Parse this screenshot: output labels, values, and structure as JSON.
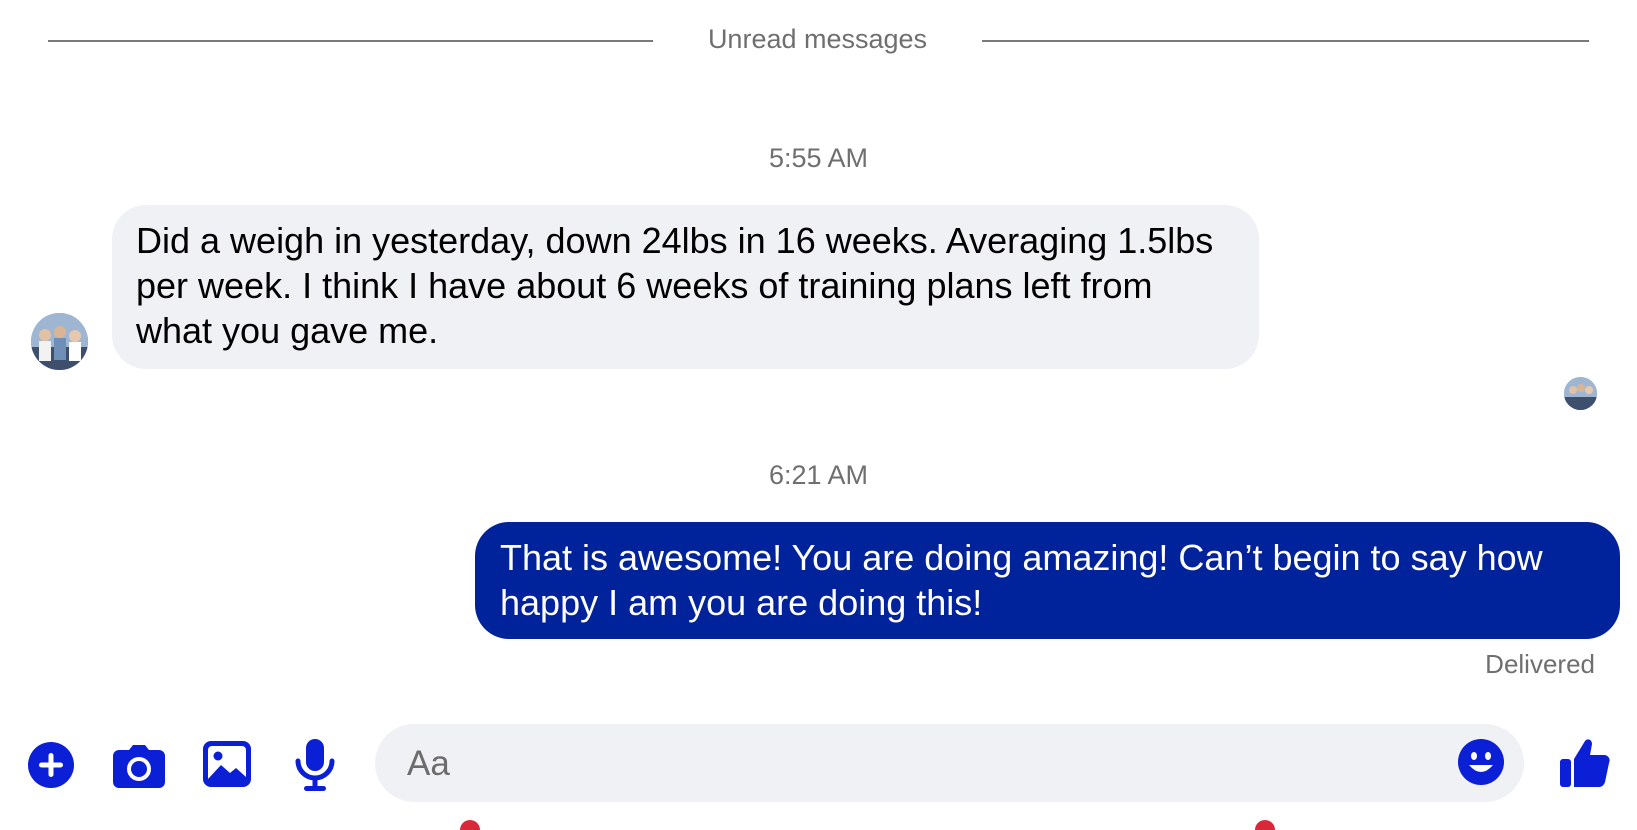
{
  "divider": {
    "label": "Unread messages"
  },
  "messages": [
    {
      "timestamp": "5:55 AM",
      "direction": "incoming",
      "text": "Did a weigh in yesterday, down 24lbs in 16 weeks. Averaging 1.5lbs per week. I think I have about 6 weeks of training plans left from what you gave me."
    },
    {
      "timestamp": "6:21 AM",
      "direction": "outgoing",
      "text": "That is awesome! You are doing amazing! Can’t begin to say how happy I am you are doing this!",
      "status": "Delivered"
    }
  ],
  "composer": {
    "placeholder": "Aa",
    "icons": [
      "plus-icon",
      "camera-icon",
      "gallery-icon",
      "microphone-icon",
      "emoji-icon",
      "thumbs-up-icon"
    ]
  },
  "colors": {
    "accent": "#0a1fd6",
    "outgoing_bubble": "#00229a",
    "incoming_bubble": "#f0f1f5",
    "muted_text": "#6f6f6f"
  }
}
